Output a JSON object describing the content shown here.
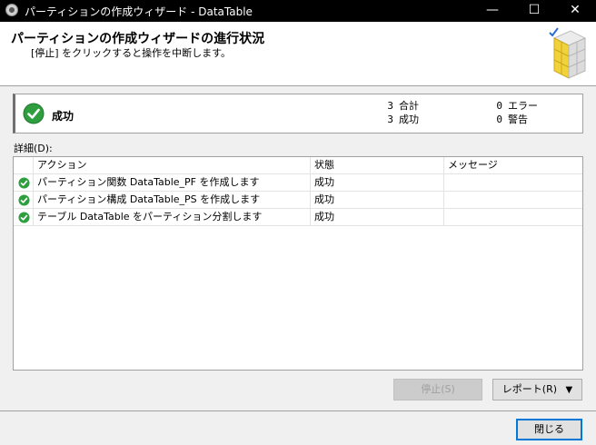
{
  "window": {
    "title": "パーティションの作成ウィザード - DataTable",
    "minimize_glyph": "—",
    "maximize_glyph": "☐",
    "close_glyph": "✕"
  },
  "header": {
    "title": "パーティションの作成ウィザードの進行状況",
    "subtitle": "[停止] をクリックすると操作を中断します。"
  },
  "status": {
    "result": "成功",
    "total_count": "3",
    "total_label": "合計",
    "success_count": "3",
    "success_label": "成功",
    "error_count": "0",
    "error_label": "エラー",
    "warning_count": "0",
    "warning_label": "警告"
  },
  "details": {
    "label": "詳細(D):",
    "columns": {
      "action": "アクション",
      "status": "状態",
      "message": "メッセージ"
    },
    "rows": [
      {
        "action": "パーティション関数 DataTable_PF を作成します",
        "status": "成功",
        "message": ""
      },
      {
        "action": "パーティション構成 DataTable_PS を作成します",
        "status": "成功",
        "message": ""
      },
      {
        "action": "テーブル DataTable をパーティション分割します",
        "status": "成功",
        "message": ""
      }
    ]
  },
  "buttons": {
    "stop": "停止(S)",
    "report": "レポート(R)",
    "report_arrow": "▼",
    "close": "閉じる"
  },
  "colors": {
    "success_green": "#2e9e3e",
    "title_bar": "#000000",
    "focus_blue": "#0078d7"
  },
  "icons": {
    "status": "success-check-icon",
    "header": "cube-icon",
    "app": "app-icon"
  }
}
